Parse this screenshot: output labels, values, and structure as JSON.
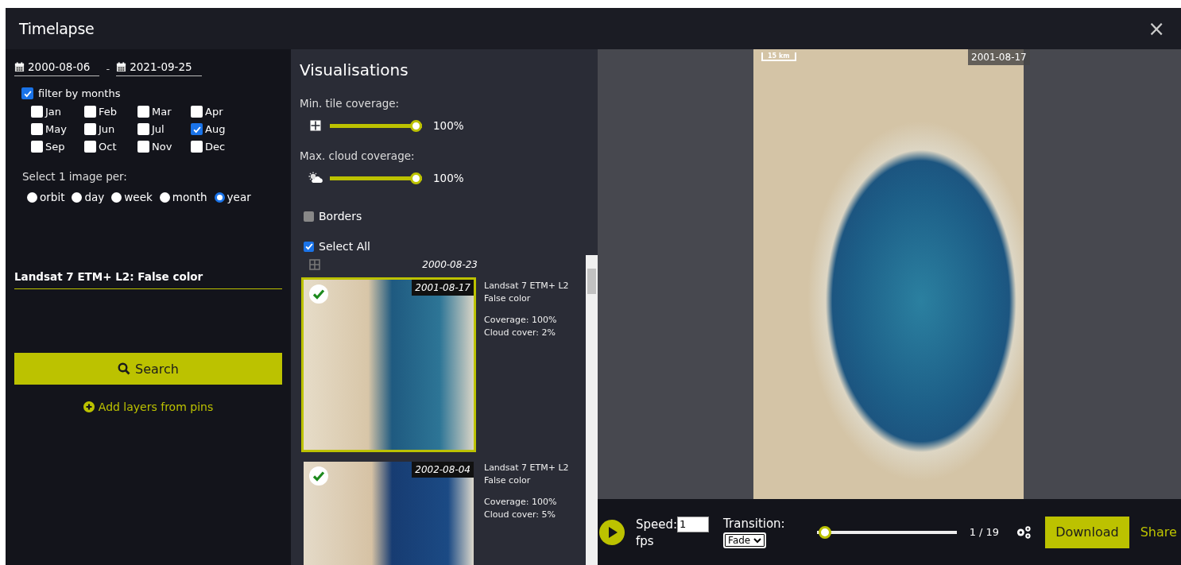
{
  "window": {
    "title": "Timelapse",
    "close": "×"
  },
  "filters": {
    "date_from": "2000-08-06",
    "separator": "-",
    "date_to": "2021-09-25",
    "filter_by_months": {
      "label": "filter by months",
      "checked": true
    },
    "months": [
      {
        "label": "Jan",
        "checked": false
      },
      {
        "label": "Feb",
        "checked": false
      },
      {
        "label": "Mar",
        "checked": false
      },
      {
        "label": "Apr",
        "checked": false
      },
      {
        "label": "May",
        "checked": false
      },
      {
        "label": "Jun",
        "checked": false
      },
      {
        "label": "Jul",
        "checked": false
      },
      {
        "label": "Aug",
        "checked": true
      },
      {
        "label": "Sep",
        "checked": false
      },
      {
        "label": "Oct",
        "checked": false
      },
      {
        "label": "Nov",
        "checked": false
      },
      {
        "label": "Dec",
        "checked": false
      }
    ],
    "select_per": {
      "label": "Select 1 image per:",
      "options": [
        {
          "label": "orbit",
          "selected": false
        },
        {
          "label": "day",
          "selected": false
        },
        {
          "label": "week",
          "selected": false
        },
        {
          "label": "month",
          "selected": false
        },
        {
          "label": "year",
          "selected": true
        }
      ]
    },
    "layer": "Landsat 7 ETM+ L2: False color",
    "search_button": "Search",
    "add_layers_link": "Add layers from pins"
  },
  "visualisations": {
    "title": "Visualisations",
    "sliders": [
      {
        "label": "Min. tile coverage:",
        "kind": "tile",
        "level": 1,
        "reading": "100%"
      },
      {
        "label": "Max. cloud coverage:",
        "kind": "cloud",
        "level": 1,
        "reading": "100%"
      }
    ],
    "borders": {
      "label": "Borders",
      "checked": false
    },
    "select_all": {
      "label": "Select All",
      "checked": true
    },
    "list_header_date": "2000-08-23",
    "images": [
      {
        "date": "2001-08-17",
        "selected": true,
        "checked": true,
        "source": "Landsat 7 ETM+ L2",
        "layer": "False color",
        "coverage": "Coverage: 100%",
        "cloud": "Cloud cover: 2%"
      },
      {
        "date": "2002-08-04",
        "selected": false,
        "checked": true,
        "source": "Landsat 7 ETM+ L2",
        "layer": "False color",
        "coverage": "Coverage: 100%",
        "cloud": "Cloud cover: 5%"
      }
    ]
  },
  "preview": {
    "scale": "15 km",
    "date": "2001-08-17"
  },
  "player": {
    "speed_label": "Speed:",
    "speed": "1",
    "unit": "fps",
    "transition_label": "Transition:",
    "transition": "Fade",
    "level": 0,
    "counter": "1 / 19",
    "download_button": "Download",
    "share_link": "Share"
  }
}
